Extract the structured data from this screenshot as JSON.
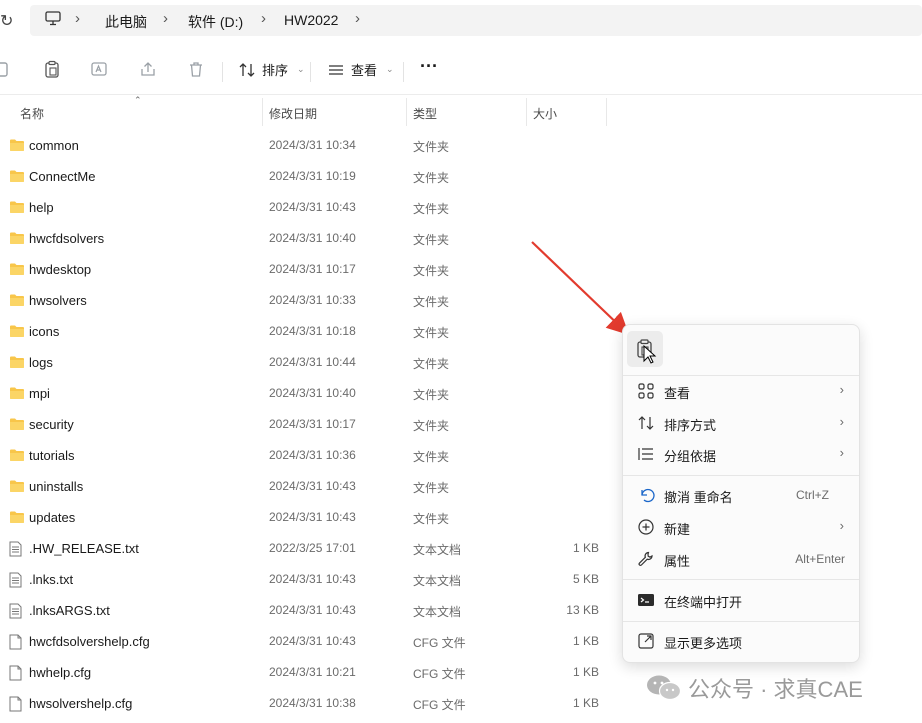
{
  "breadcrumb": {
    "items": [
      "此电脑",
      "软件 (D:)",
      "HW2022"
    ]
  },
  "toolbar": {
    "sort_label": "排序",
    "view_label": "查看",
    "more_label": "···"
  },
  "columns": {
    "name": "名称",
    "date": "修改日期",
    "type": "类型",
    "size": "大小"
  },
  "files": [
    {
      "name": "common",
      "date": "2024/3/31 10:34",
      "type": "文件夹",
      "size": "",
      "kind": "folder"
    },
    {
      "name": "ConnectMe",
      "date": "2024/3/31 10:19",
      "type": "文件夹",
      "size": "",
      "kind": "folder"
    },
    {
      "name": "help",
      "date": "2024/3/31 10:43",
      "type": "文件夹",
      "size": "",
      "kind": "folder"
    },
    {
      "name": "hwcfdsolvers",
      "date": "2024/3/31 10:40",
      "type": "文件夹",
      "size": "",
      "kind": "folder"
    },
    {
      "name": "hwdesktop",
      "date": "2024/3/31 10:17",
      "type": "文件夹",
      "size": "",
      "kind": "folder"
    },
    {
      "name": "hwsolvers",
      "date": "2024/3/31 10:33",
      "type": "文件夹",
      "size": "",
      "kind": "folder"
    },
    {
      "name": "icons",
      "date": "2024/3/31 10:18",
      "type": "文件夹",
      "size": "",
      "kind": "folder"
    },
    {
      "name": "logs",
      "date": "2024/3/31 10:44",
      "type": "文件夹",
      "size": "",
      "kind": "folder"
    },
    {
      "name": "mpi",
      "date": "2024/3/31 10:40",
      "type": "文件夹",
      "size": "",
      "kind": "folder"
    },
    {
      "name": "security",
      "date": "2024/3/31 10:17",
      "type": "文件夹",
      "size": "",
      "kind": "folder"
    },
    {
      "name": "tutorials",
      "date": "2024/3/31 10:36",
      "type": "文件夹",
      "size": "",
      "kind": "folder"
    },
    {
      "name": "uninstalls",
      "date": "2024/3/31 10:43",
      "type": "文件夹",
      "size": "",
      "kind": "folder"
    },
    {
      "name": "updates",
      "date": "2024/3/31 10:43",
      "type": "文件夹",
      "size": "",
      "kind": "folder"
    },
    {
      "name": ".HW_RELEASE.txt",
      "date": "2022/3/25 17:01",
      "type": "文本文档",
      "size": "1 KB",
      "kind": "text"
    },
    {
      "name": ".lnks.txt",
      "date": "2024/3/31 10:43",
      "type": "文本文档",
      "size": "5 KB",
      "kind": "text"
    },
    {
      "name": ".lnksARGS.txt",
      "date": "2024/3/31 10:43",
      "type": "文本文档",
      "size": "13 KB",
      "kind": "text"
    },
    {
      "name": "hwcfdsolvershelp.cfg",
      "date": "2024/3/31 10:43",
      "type": "CFG 文件",
      "size": "1 KB",
      "kind": "file"
    },
    {
      "name": "hwhelp.cfg",
      "date": "2024/3/31 10:21",
      "type": "CFG 文件",
      "size": "1 KB",
      "kind": "file"
    },
    {
      "name": "hwsolvershelp.cfg",
      "date": "2024/3/31 10:38",
      "type": "CFG 文件",
      "size": "1 KB",
      "kind": "file"
    }
  ],
  "context_menu": {
    "items": [
      {
        "label": "查看",
        "shortcut": "",
        "submenu": true,
        "icon": "grid-icon"
      },
      {
        "label": "排序方式",
        "shortcut": "",
        "submenu": true,
        "icon": "sort-icon"
      },
      {
        "label": "分组依据",
        "shortcut": "",
        "submenu": true,
        "icon": "group-list-icon"
      },
      {
        "label": "撤消 重命名",
        "shortcut": "Ctrl+Z",
        "submenu": false,
        "icon": "undo-icon"
      },
      {
        "label": "新建",
        "shortcut": "",
        "submenu": true,
        "icon": "plus-circle-icon"
      },
      {
        "label": "属性",
        "shortcut": "Alt+Enter",
        "submenu": false,
        "icon": "wrench-icon"
      },
      {
        "label": "在终端中打开",
        "shortcut": "",
        "submenu": false,
        "icon": "terminal-icon"
      },
      {
        "label": "显示更多选项",
        "shortcut": "",
        "submenu": false,
        "icon": "share-out-icon"
      }
    ]
  },
  "watermark": {
    "text": "公众号 · 求真CAE"
  },
  "colors": {
    "folder": "#f8c64a",
    "arrow": "#e23b2e"
  }
}
